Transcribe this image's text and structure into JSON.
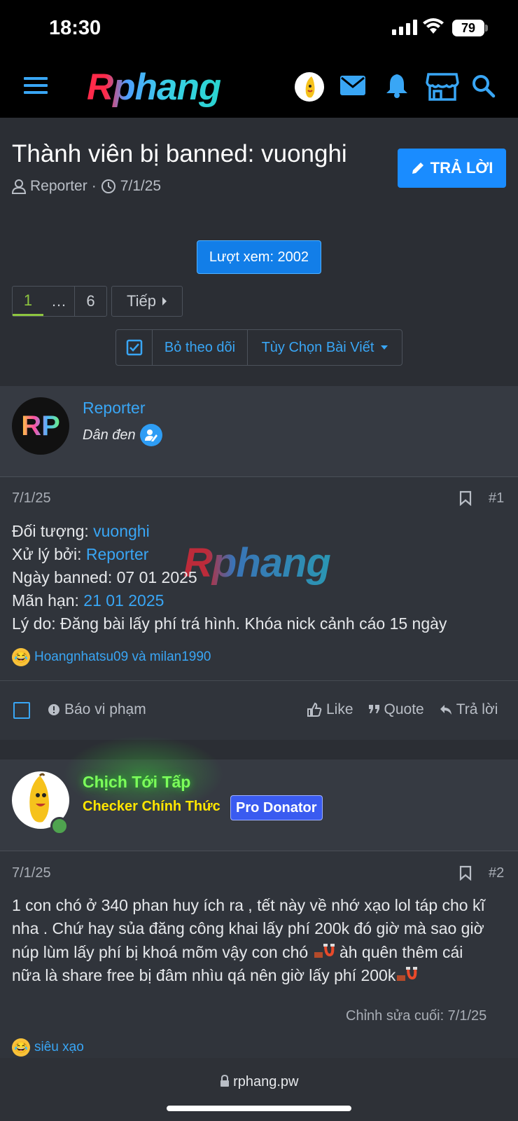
{
  "status": {
    "time": "18:30",
    "battery": "79"
  },
  "header": {
    "logo": "Rphang"
  },
  "thread": {
    "title": "Thành viên bị banned: vuonghi",
    "author": "Reporter",
    "date": "7/1/25",
    "reply_label": "TRẢ LỜI",
    "views_label": "Lượt xem: 2002"
  },
  "pagination": {
    "current": "1",
    "dots": "…",
    "last": "6",
    "next": "Tiếp"
  },
  "thread_tools": {
    "unwatch": "Bỏ theo dõi",
    "options": "Tùy Chọn Bài Viết"
  },
  "posts": [
    {
      "username": "Reporter",
      "avatar_text": "RP",
      "user_title": "Dân đen",
      "date": "7/1/25",
      "number": "#1",
      "watermark": "Rphang",
      "lines": {
        "l1_label": "Đối tượng: ",
        "l1_value": "vuonghi",
        "l2_label": "Xử lý bởi: ",
        "l2_value": "Reporter",
        "l3": "Ngày banned: 07 01 2025",
        "l4_label": "Mãn hạn: ",
        "l4_value": "21 01 2025",
        "l5": "Lý do: Đăng bài lấy phí trá hình. Khóa nick cảnh cáo 15 ngày"
      },
      "reactions": "Hoangnhatsu09 và milan1990",
      "actions": {
        "report": "Báo vi phạm",
        "like": "Like",
        "quote": "Quote",
        "reply": "Trả lời"
      }
    },
    {
      "username": "Chịch Tới Tấp",
      "user_title": "Checker Chính Thức",
      "badge": "Pro Donator",
      "date": "7/1/25",
      "number": "#2",
      "lines": {
        "l1": "1 con chó ở 340 phan huy ích ra , tết này về nhớ xạo lol táp cho kĩ",
        "l2": "nha . Chứ hay sủa đăng công khai lấy phí 200k đó giờ mà sao giờ",
        "l3a": "núp lùm lấy phí bị khoá mõm vậy con chó ",
        "l3b": " àh quên thêm cái",
        "l4": "nữa là share free bị đâm nhìu qá nên giờ lấy phí 200k"
      },
      "edited": "Chỉnh sửa cuối: 7/1/25",
      "reactions": "siêu xạo"
    }
  ],
  "browser": {
    "url": "rphang.pw"
  }
}
